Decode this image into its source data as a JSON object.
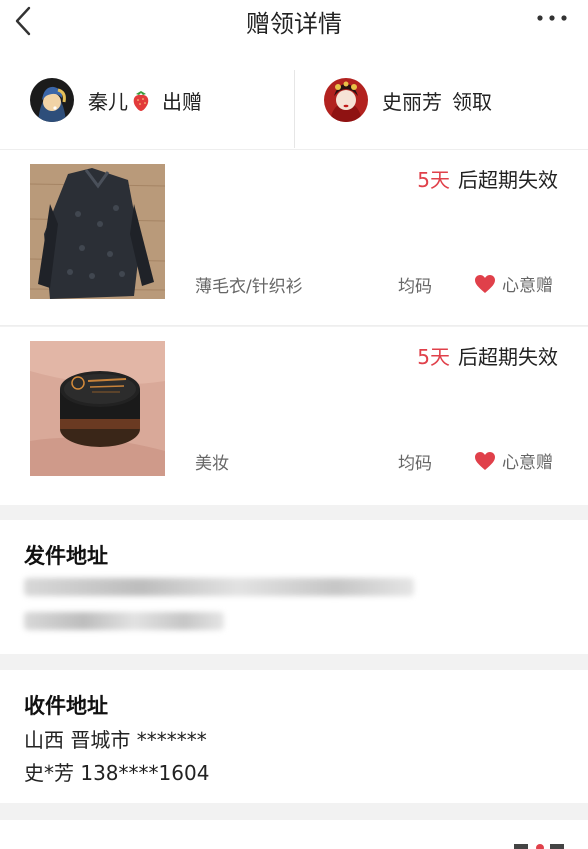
{
  "header": {
    "title": "赠领详情"
  },
  "giver": {
    "name": "秦儿",
    "action": "出赠"
  },
  "receiver": {
    "name": "史丽芳",
    "action": "领取"
  },
  "items": [
    {
      "expiry_days": "5天",
      "expiry_text": "后超期失效",
      "category": "薄毛衣/针织衫",
      "size": "均码",
      "gift_label": "心意赠"
    },
    {
      "expiry_days": "5天",
      "expiry_text": "后超期失效",
      "category": "美妆",
      "size": "均码",
      "gift_label": "心意赠"
    }
  ],
  "send_address": {
    "title": "发件地址"
  },
  "recv_address": {
    "title": "收件地址",
    "region": "山西 晋城市 *******",
    "contact": "史*芳 138****1604"
  },
  "colors": {
    "accent_red": "#e0404a",
    "background": "#f2f2f2"
  },
  "icons": [
    "back-icon",
    "more-icon",
    "strawberry-icon",
    "heart-icon"
  ]
}
